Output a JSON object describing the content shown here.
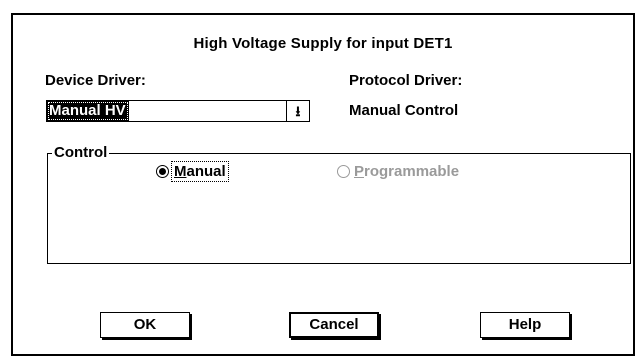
{
  "dialog": {
    "title": "High Voltage Supply for input DET1"
  },
  "device_driver": {
    "label": "Device Driver:",
    "selected": "Manual HV",
    "dropdown_glyph": "⭳"
  },
  "protocol_driver": {
    "label": "Protocol Driver:",
    "value": "Manual Control"
  },
  "control_group": {
    "label": "Control",
    "options": [
      {
        "first_letter": "M",
        "rest": "anual",
        "checked": true,
        "enabled": true
      },
      {
        "first_letter": "P",
        "rest": "rogrammable",
        "checked": false,
        "enabled": false
      }
    ]
  },
  "buttons": {
    "ok": "OK",
    "cancel": "Cancel",
    "help": "Help"
  }
}
